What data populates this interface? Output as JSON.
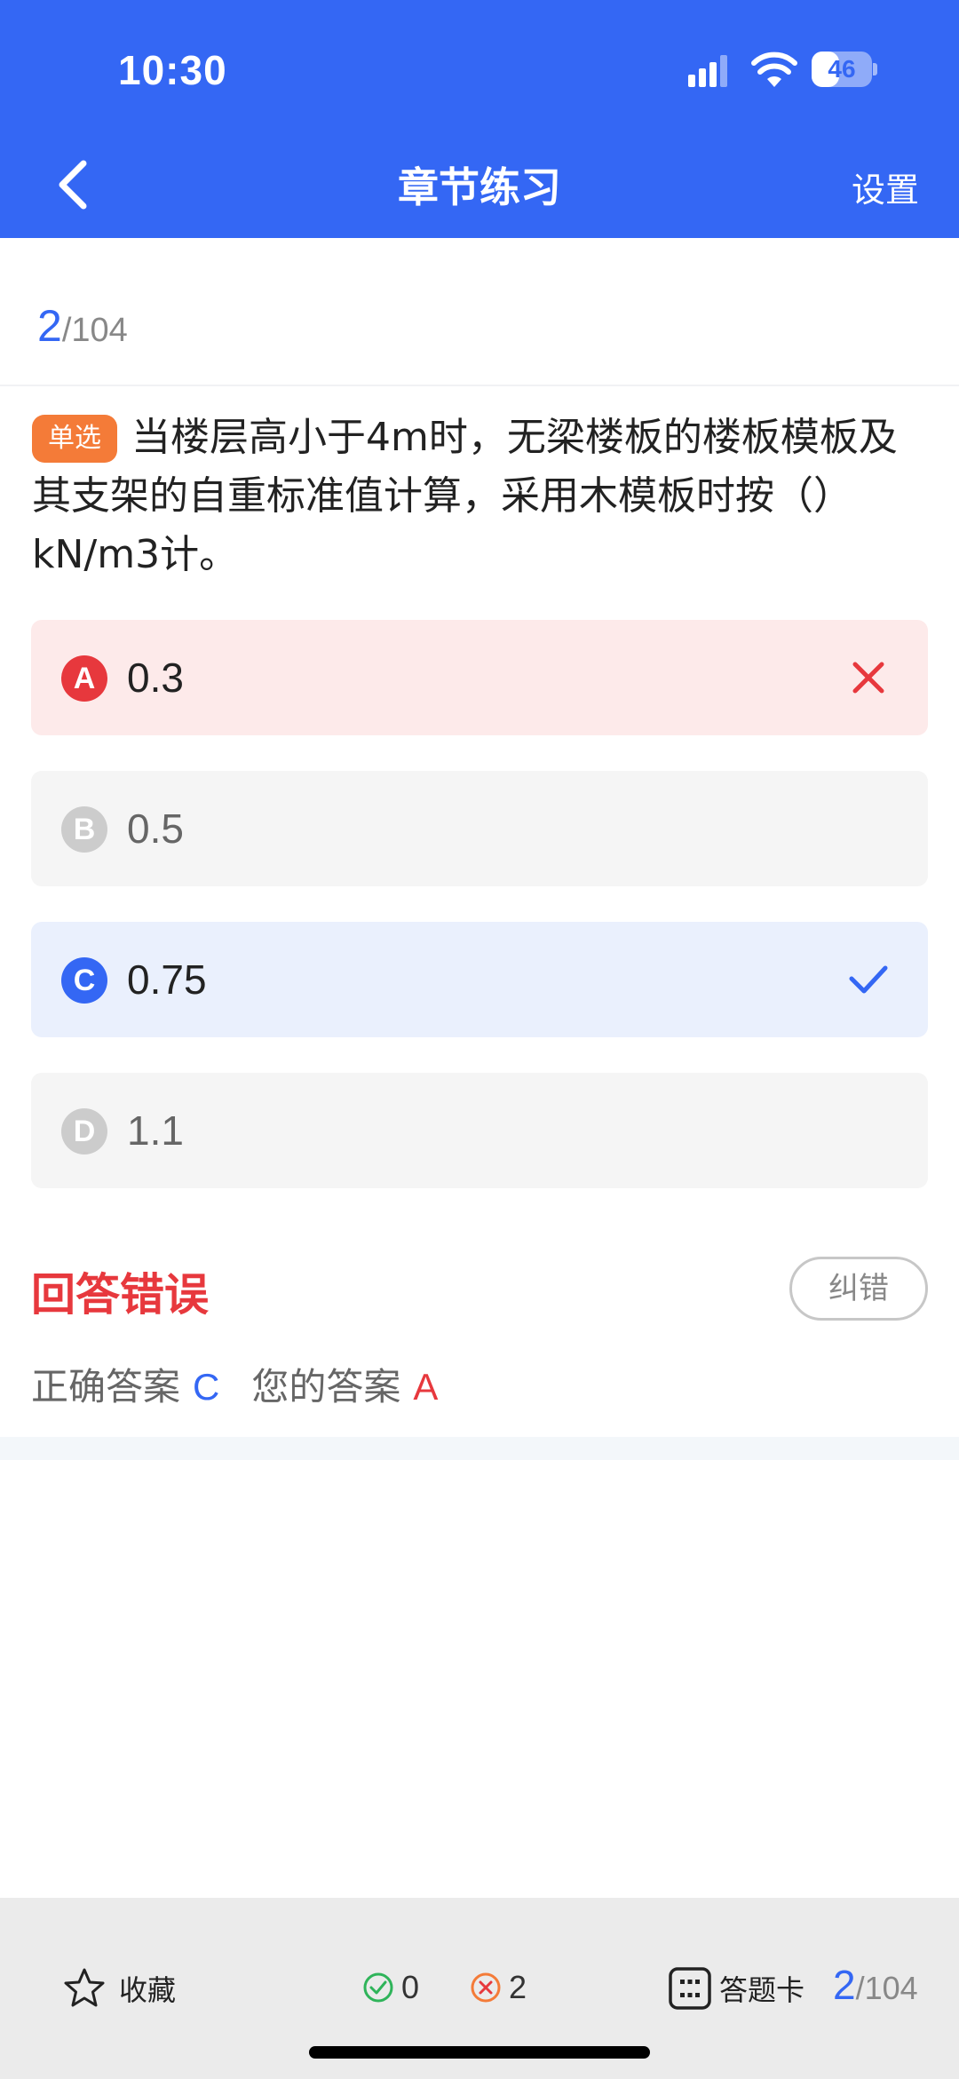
{
  "status_bar": {
    "time": "10:30",
    "battery_level": "46",
    "icons": [
      "cellular-signal-icon",
      "wifi-icon",
      "battery-icon"
    ]
  },
  "nav": {
    "back_icon": "chevron-left-icon",
    "title": "章节练习",
    "settings_label": "设置"
  },
  "progress": {
    "current": "2",
    "separator": "/",
    "total": "104"
  },
  "question": {
    "type_tag": "单选",
    "text": "当楼层高小于4m时，无梁楼板的楼板模板及其支架的自重标准值计算，采用木模板时按（）kN/m3计。"
  },
  "options": [
    {
      "letter": "A",
      "text": "0.3",
      "state": "wrong",
      "mark_icon": "cross-icon"
    },
    {
      "letter": "B",
      "text": "0.5",
      "state": "normal"
    },
    {
      "letter": "C",
      "text": "0.75",
      "state": "right",
      "mark_icon": "check-icon"
    },
    {
      "letter": "D",
      "text": "1.1",
      "state": "normal"
    }
  ],
  "result": {
    "title": "回答错误",
    "report_label": "纠错",
    "correct_label": "正确答案",
    "correct_value": "C",
    "yours_label": "您的答案",
    "yours_value": "A"
  },
  "bottom_bar": {
    "favorite_label": "收藏",
    "correct_count": "0",
    "wrong_count": "2",
    "card_label": "答题卡",
    "current": "2",
    "separator": "/",
    "total": "104"
  },
  "colors": {
    "primary": "#3467f4",
    "error": "#e7383d",
    "tag": "#f47b38",
    "success": "#2fb45a"
  }
}
